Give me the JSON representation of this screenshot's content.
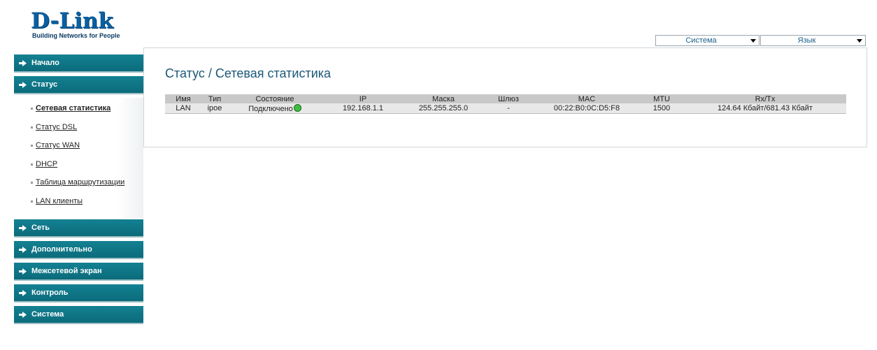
{
  "brand": {
    "logo_text": "D-Link",
    "tagline": "Building Networks for People"
  },
  "top_selects": {
    "system": "Система",
    "language": "Язык"
  },
  "sidebar": {
    "main_items": [
      {
        "label": "Начало"
      },
      {
        "label": "Статус"
      },
      {
        "label": "Сеть"
      },
      {
        "label": "Дополнительно"
      },
      {
        "label": "Межсетевой экран"
      },
      {
        "label": "Контроль"
      },
      {
        "label": "Система"
      }
    ],
    "status_subitems": [
      {
        "label": "Сетевая статистика",
        "active": true
      },
      {
        "label": "Статус DSL"
      },
      {
        "label": "Статус WAN"
      },
      {
        "label": "DHCP"
      },
      {
        "label": "Таблица маршрутизации"
      },
      {
        "label": "LAN клиенты"
      }
    ]
  },
  "page": {
    "title": "Статус /  Сетевая статистика"
  },
  "table": {
    "headers": [
      "Имя",
      "Тип",
      "Состояние",
      "IP",
      "Маска",
      "Шлюз",
      "MAC",
      "MTU",
      "Rx/Tx"
    ],
    "rows": [
      {
        "name": "LAN",
        "type": "ipoe",
        "state": "Подключено",
        "ip": "192.168.1.1",
        "mask": "255.255.255.0",
        "gateway": "-",
        "mac": "00:22:B0:0C:D5:F8",
        "mtu": "1500",
        "rxtx": "124.64 Кбайт/681.43 Кбайт"
      }
    ]
  },
  "colors": {
    "nav_teal": "#0f7686",
    "title_blue": "#1b5877",
    "status_green": "#3fbf3f"
  }
}
